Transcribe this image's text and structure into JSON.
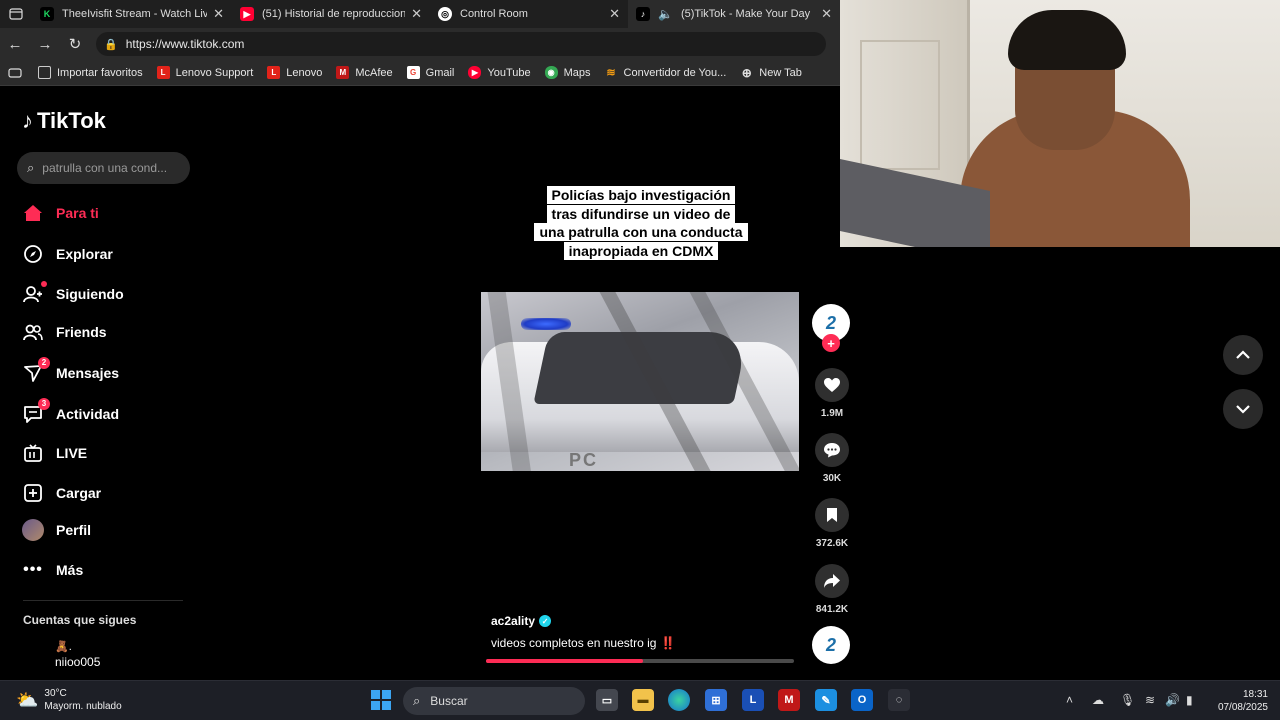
{
  "browser": {
    "tabs": [
      {
        "title": "TheeIvisfit Stream - Watch Live on",
        "favicon_color": "#1ed760",
        "favicon_text": "K",
        "active": false
      },
      {
        "title": "(51) Historial de reproducciones -",
        "favicon_color": "#ff0033",
        "favicon_text": "▶",
        "active": false
      },
      {
        "title": "Control Room",
        "favicon_color": "#ffffff",
        "favicon_text": "◎",
        "active": false
      },
      {
        "title": "(5)TikTok - Make Your Day",
        "favicon_color": "#000000",
        "favicon_text": "♪",
        "active": true
      }
    ],
    "address": "https://www.tiktok.com",
    "bookmarks": [
      {
        "label": "Importar favoritos",
        "color": "#888888",
        "icon": "folder-icon"
      },
      {
        "label": "Lenovo Support",
        "color": "#e2231a",
        "icon": "L"
      },
      {
        "label": "Lenovo",
        "color": "#e2231a",
        "icon": "L"
      },
      {
        "label": "McAfee",
        "color": "#c01818",
        "icon": "M"
      },
      {
        "label": "Gmail",
        "color": "#ffffff",
        "icon": "G"
      },
      {
        "label": "YouTube",
        "color": "#ff0033",
        "icon": "▶"
      },
      {
        "label": "Maps",
        "color": "#34a853",
        "icon": "◉"
      },
      {
        "label": "Convertidor de You...",
        "color": "#f39c12",
        "icon": "≋"
      },
      {
        "label": "New Tab",
        "color": "#cccccc",
        "icon": "globe-icon"
      }
    ]
  },
  "tiktok": {
    "logo": "TikTok",
    "search_placeholder": "patrulla con una cond...",
    "nav": [
      {
        "label": "Para ti",
        "icon": "home-icon",
        "active": true
      },
      {
        "label": "Explorar",
        "icon": "compass-icon"
      },
      {
        "label": "Siguiendo",
        "icon": "following-icon",
        "dot": true
      },
      {
        "label": "Friends",
        "icon": "friends-icon"
      },
      {
        "label": "Mensajes",
        "icon": "messages-icon",
        "badge": "2"
      },
      {
        "label": "Actividad",
        "icon": "activity-icon",
        "badge": "3"
      },
      {
        "label": "LIVE",
        "icon": "live-icon"
      },
      {
        "label": "Cargar",
        "icon": "upload-icon"
      },
      {
        "label": "Perfil",
        "icon": "profile-avatar"
      },
      {
        "label": "Más",
        "icon": "more-icon"
      }
    ],
    "following_title": "Cuentas que sigues",
    "following_user": {
      "emoji": "🧸.",
      "name": "niioo005"
    },
    "video": {
      "caption": [
        "Policías bajo investigación",
        "tras difundirse un video de",
        "una patrulla con una conducta",
        "inapropiada en CDMX"
      ],
      "car_label": "PC",
      "author": "ac2ality",
      "description": "videos completos en nuestro ig",
      "description_mark": "‼️",
      "progress_fraction": 0.51
    },
    "actions": {
      "avatar_text": "2",
      "likes": "1.9M",
      "comments": "30K",
      "saves": "372.6K",
      "shares": "841.2K"
    }
  },
  "taskbar": {
    "weather_temp": "30°C",
    "weather_desc": "Mayorm. nublado",
    "search_label": "Buscar",
    "time": "18:31",
    "date": "07/08/2025"
  },
  "colors": {
    "accent": "#fe2c55",
    "verified": "#20d5ec"
  }
}
